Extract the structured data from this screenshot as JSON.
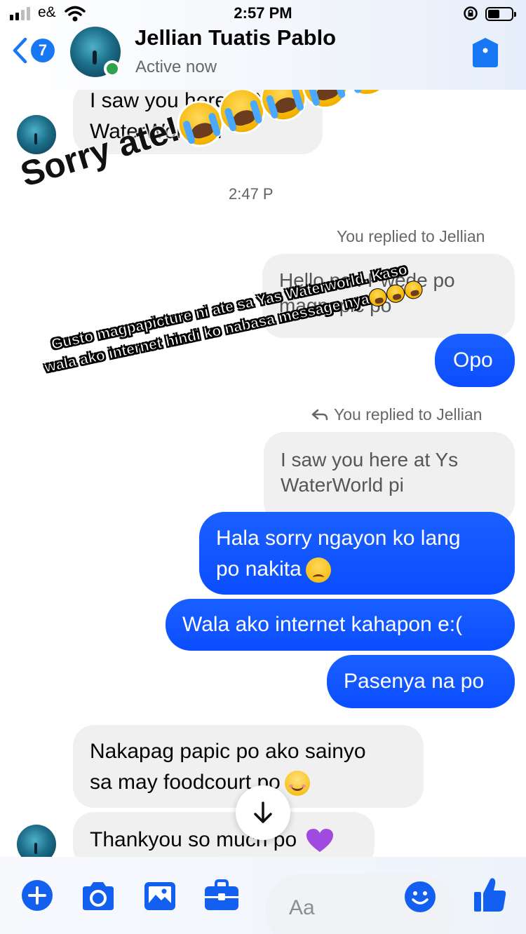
{
  "status_bar": {
    "carrier": "e&",
    "time": "2:57 PM"
  },
  "header": {
    "back_badge": "7",
    "contact_name": "Jellian Tuatis Pablo",
    "contact_status": "Active now",
    "accent_color": "#1877f2",
    "online_color": "#31a24c"
  },
  "messages": {
    "m1": [
      "I saw you here at Ys",
      "WaterWorld pi"
    ],
    "timestamp": "2:47 P",
    "reply_label_1": "You replied to Jellian",
    "quote_1": [
      "Hello po . Pwede po",
      "magpapic po"
    ],
    "m2": "Opo",
    "reply_label_2": "You replied to Jellian",
    "quote_2": [
      "I saw you here at Ys",
      "WaterWorld pi"
    ],
    "m3": [
      "Hala sorry ngayon ko lang",
      "po nakita"
    ],
    "m4": "Wala ako internet kahapon e:(",
    "m5": "Pasenya na po",
    "m6": [
      "Nakapag papic po ako sainyo",
      "sa may foodcourt po"
    ],
    "m7": "Thankyou so much po"
  },
  "overlay": {
    "sorry_text": "Sorry ate!",
    "caption": "Gusto magpapicture ni ate sa Yas Waterworld. Kaso wala ako internet hindi ko nabasa message nya"
  },
  "composer": {
    "placeholder": "Aa"
  },
  "icons": [
    "plus-icon",
    "camera-icon",
    "image-icon",
    "briefcase-icon",
    "smiley-icon",
    "thumbs-up-icon",
    "shield-icon",
    "back-chevron-icon",
    "arrow-down-icon"
  ]
}
